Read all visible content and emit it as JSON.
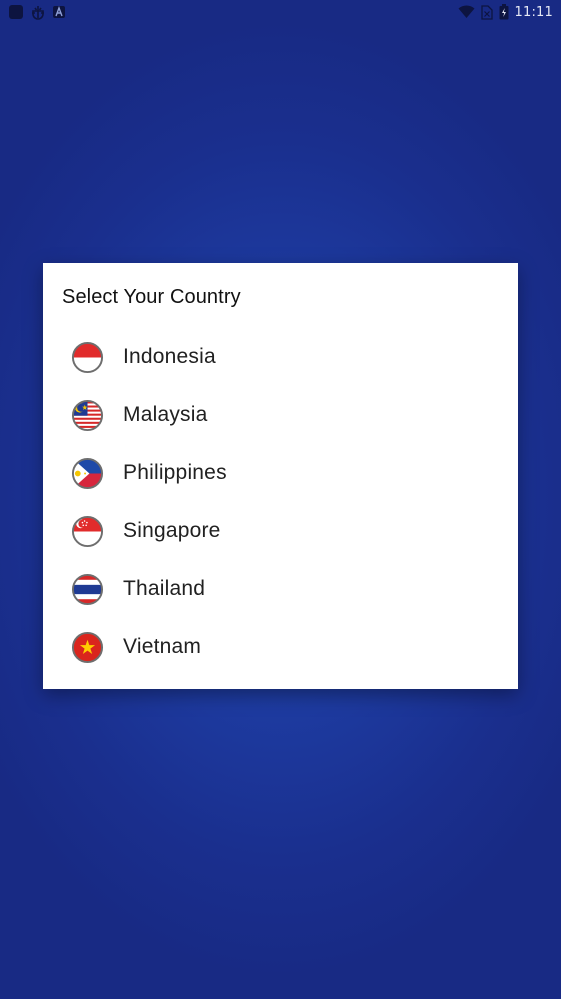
{
  "status_bar": {
    "time": "11:11",
    "icons": [
      "app-icon",
      "bug-icon",
      "font-icon",
      "wifi-icon",
      "sim-icon",
      "battery-icon"
    ]
  },
  "dialog": {
    "title": "Select Your Country",
    "countries": [
      {
        "name": "Indonesia",
        "flag": "indonesia-flag-icon"
      },
      {
        "name": "Malaysia",
        "flag": "malaysia-flag-icon"
      },
      {
        "name": "Philippines",
        "flag": "philippines-flag-icon"
      },
      {
        "name": "Singapore",
        "flag": "singapore-flag-icon"
      },
      {
        "name": "Thailand",
        "flag": "thailand-flag-icon"
      },
      {
        "name": "Vietnam",
        "flag": "vietnam-flag-icon"
      }
    ]
  },
  "colors": {
    "background": "#1d3a9f",
    "dialog_background": "#ffffff",
    "text": "#212121"
  }
}
